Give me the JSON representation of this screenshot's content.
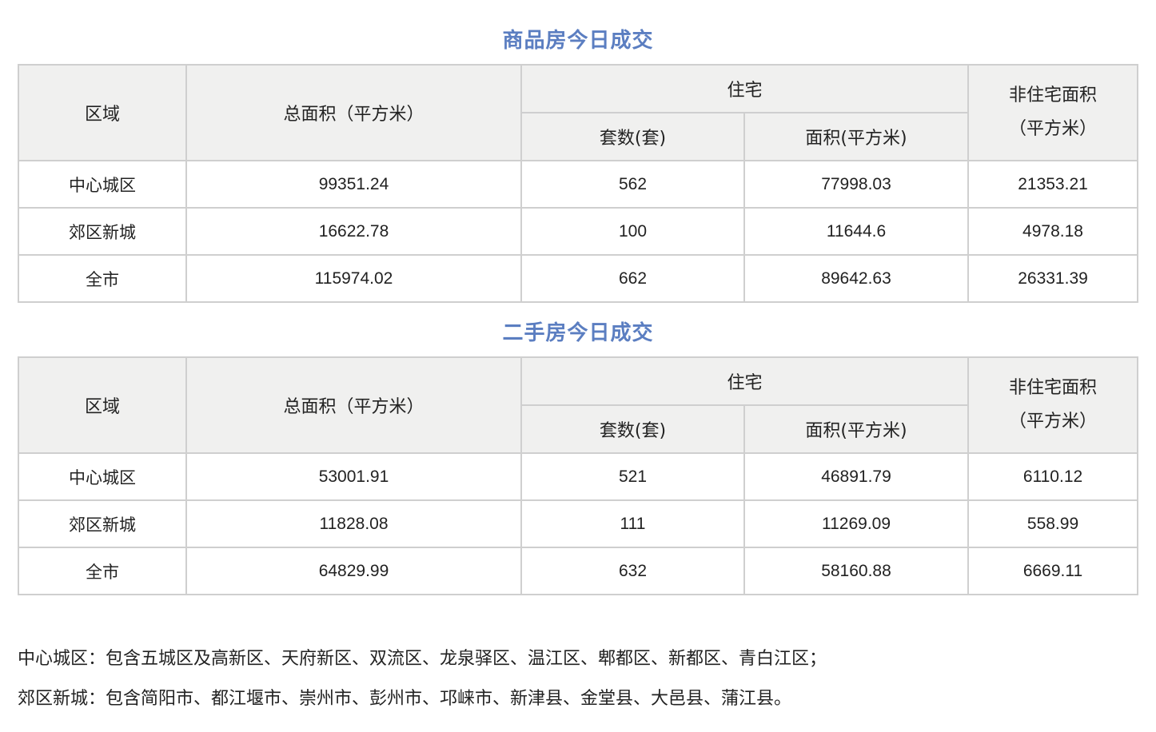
{
  "tables": [
    {
      "title": "商品房今日成交",
      "headers": {
        "region": "区域",
        "total_area": "总面积（平方米）",
        "residential": "住宅",
        "units": "套数(套)",
        "res_area": "面积(平方米)",
        "nonres_line1": "非住宅面积",
        "nonres_line2": "（平方米）"
      },
      "rows": [
        {
          "region": "中心城区",
          "total_area": "99351.24",
          "units": "562",
          "res_area": "77998.03",
          "nonres_area": "21353.21"
        },
        {
          "region": "郊区新城",
          "total_area": "16622.78",
          "units": "100",
          "res_area": "11644.6",
          "nonres_area": "4978.18"
        },
        {
          "region": "全市",
          "total_area": "115974.02",
          "units": "662",
          "res_area": "89642.63",
          "nonres_area": "26331.39"
        }
      ]
    },
    {
      "title": "二手房今日成交",
      "headers": {
        "region": "区域",
        "total_area": "总面积（平方米）",
        "residential": "住宅",
        "units": "套数(套)",
        "res_area": "面积(平方米)",
        "nonres_line1": "非住宅面积",
        "nonres_line2": "（平方米）"
      },
      "rows": [
        {
          "region": "中心城区",
          "total_area": "53001.91",
          "units": "521",
          "res_area": "46891.79",
          "nonres_area": "6110.12"
        },
        {
          "region": "郊区新城",
          "total_area": "11828.08",
          "units": "111",
          "res_area": "11269.09",
          "nonres_area": "558.99"
        },
        {
          "region": "全市",
          "total_area": "64829.99",
          "units": "632",
          "res_area": "58160.88",
          "nonres_area": "6669.11"
        }
      ]
    }
  ],
  "notes": [
    "中心城区：包含五城区及高新区、天府新区、双流区、龙泉驿区、温江区、郫都区、新都区、青白江区；",
    "郊区新城：包含简阳市、都江堰市、崇州市、彭州市、邛崃市、新津县、金堂县、大邑县、蒲江县。"
  ],
  "colors": {
    "title": "#5b7ec1",
    "header_bg": "#f0f0ef",
    "border": "#cfcfcf"
  }
}
